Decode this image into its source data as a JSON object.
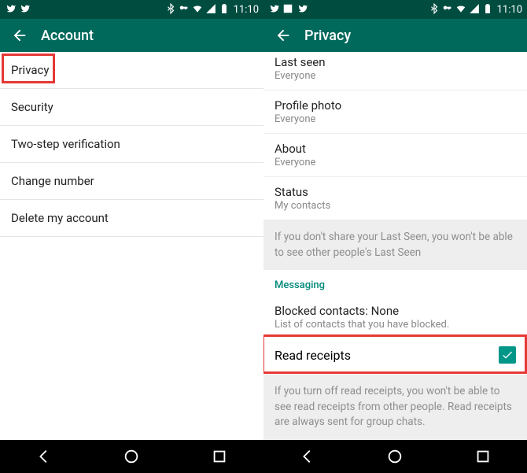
{
  "statusbar": {
    "time": "11:10",
    "icons_left": [
      "twitter",
      "twitter",
      "image"
    ],
    "icons_right": [
      "bluetooth",
      "key",
      "wifi",
      "signal",
      "battery"
    ]
  },
  "left_phone": {
    "title": "Account",
    "items": [
      "Privacy",
      "Security",
      "Two-step verification",
      "Change number",
      "Delete my account"
    ]
  },
  "right_phone": {
    "title": "Privacy",
    "settings": [
      {
        "title": "Last seen",
        "sub": "Everyone"
      },
      {
        "title": "Profile photo",
        "sub": "Everyone"
      },
      {
        "title": "About",
        "sub": "Everyone"
      },
      {
        "title": "Status",
        "sub": "My contacts"
      }
    ],
    "lastseen_info": "If you don't share your Last Seen, you won't be able to see other people's Last Seen",
    "messaging_header": "Messaging",
    "blocked": {
      "title": "Blocked contacts: None",
      "sub": "List of contacts that you have blocked."
    },
    "read_receipts_label": "Read receipts",
    "read_receipts_checked": true,
    "read_info": "If you turn off read receipts, you won't be able to see read receipts from other people. Read receipts are always sent for group chats."
  }
}
